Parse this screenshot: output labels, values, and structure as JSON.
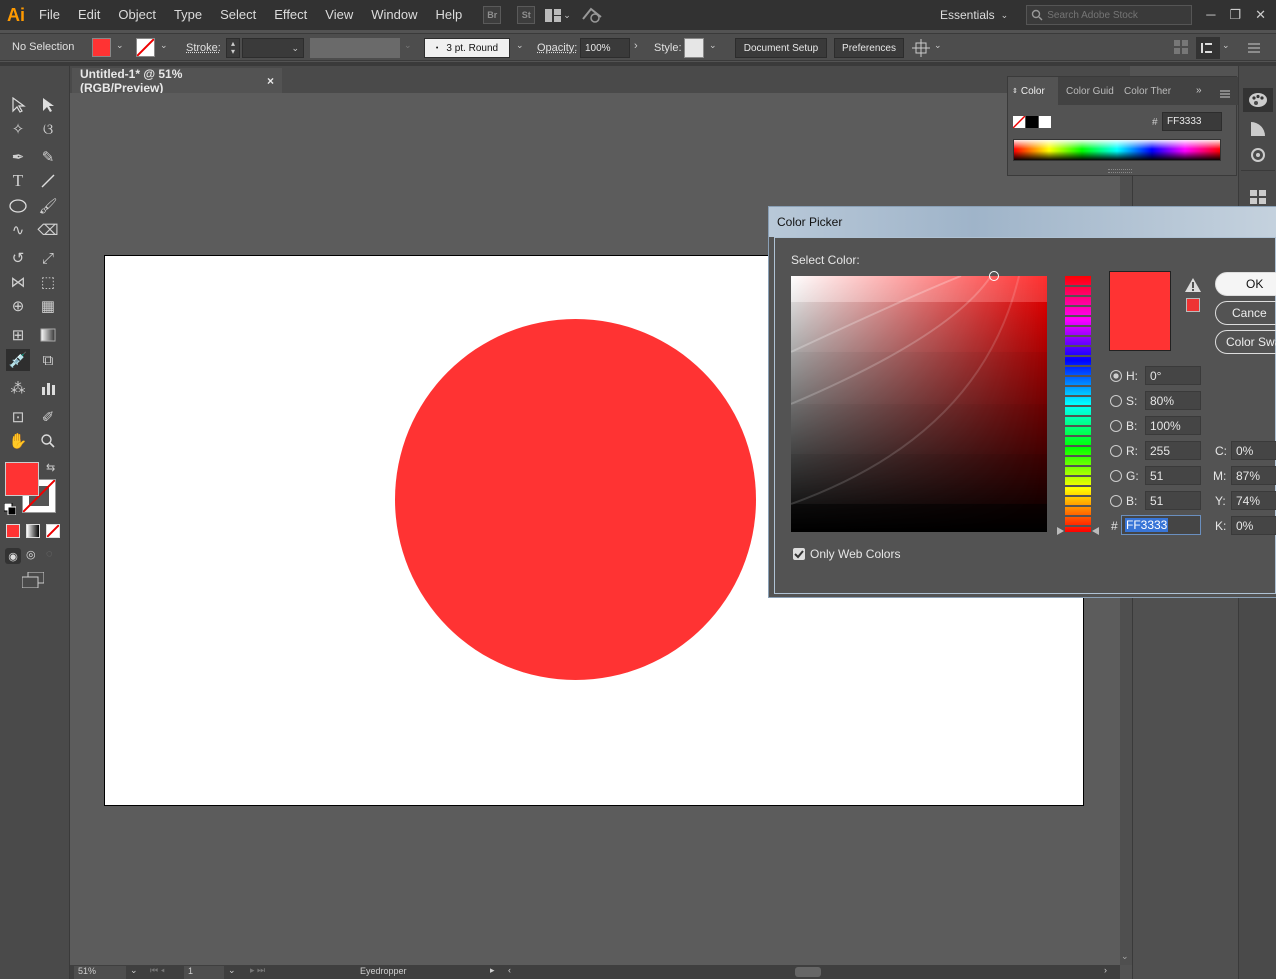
{
  "app": {
    "logo": "Ai"
  },
  "menu": [
    "File",
    "Edit",
    "Object",
    "Type",
    "Select",
    "Effect",
    "View",
    "Window",
    "Help"
  ],
  "bridge": [
    "Br",
    "St"
  ],
  "workspace": "Essentials",
  "search": {
    "placeholder": "Search Adobe Stock"
  },
  "control": {
    "selection": "No Selection",
    "stroke_label": "Stroke:",
    "brush": "3 pt. Round",
    "opacity_label": "Opacity:",
    "opacity": "100%",
    "style_label": "Style:",
    "document_setup": "Document Setup",
    "preferences": "Preferences"
  },
  "document": {
    "tab": "Untitled-1* @ 51% (RGB/Preview)",
    "close": "×"
  },
  "color_panel": {
    "tabs": [
      "Color",
      "Color Guid",
      "Color Ther"
    ],
    "hex_label": "#",
    "hex": "FF3333"
  },
  "picker": {
    "title": "Color Picker",
    "select_label": "Select Color:",
    "ok": "OK",
    "cancel": "Cance",
    "swatches": "Color Swa",
    "h_label": "H:",
    "h": "0°",
    "s_label": "S:",
    "s": "80%",
    "b_label": "B:",
    "b": "100%",
    "r_label": "R:",
    "r": "255",
    "g_label": "G:",
    "g": "51",
    "bb_label": "B:",
    "bb": "51",
    "c_label": "C:",
    "c": "0%",
    "m_label": "M:",
    "m": "87%",
    "y_label": "Y:",
    "y": "74%",
    "k_label": "K:",
    "k": "0%",
    "hex_label": "#",
    "hex": "FF3333",
    "web_only": "Only Web Colors",
    "web_only_checked": true
  },
  "status": {
    "zoom": "51%",
    "artboard": "1",
    "tool": "Eyedropper"
  },
  "colors": {
    "fill": "#ff3333",
    "accent": "#ff9a00"
  }
}
